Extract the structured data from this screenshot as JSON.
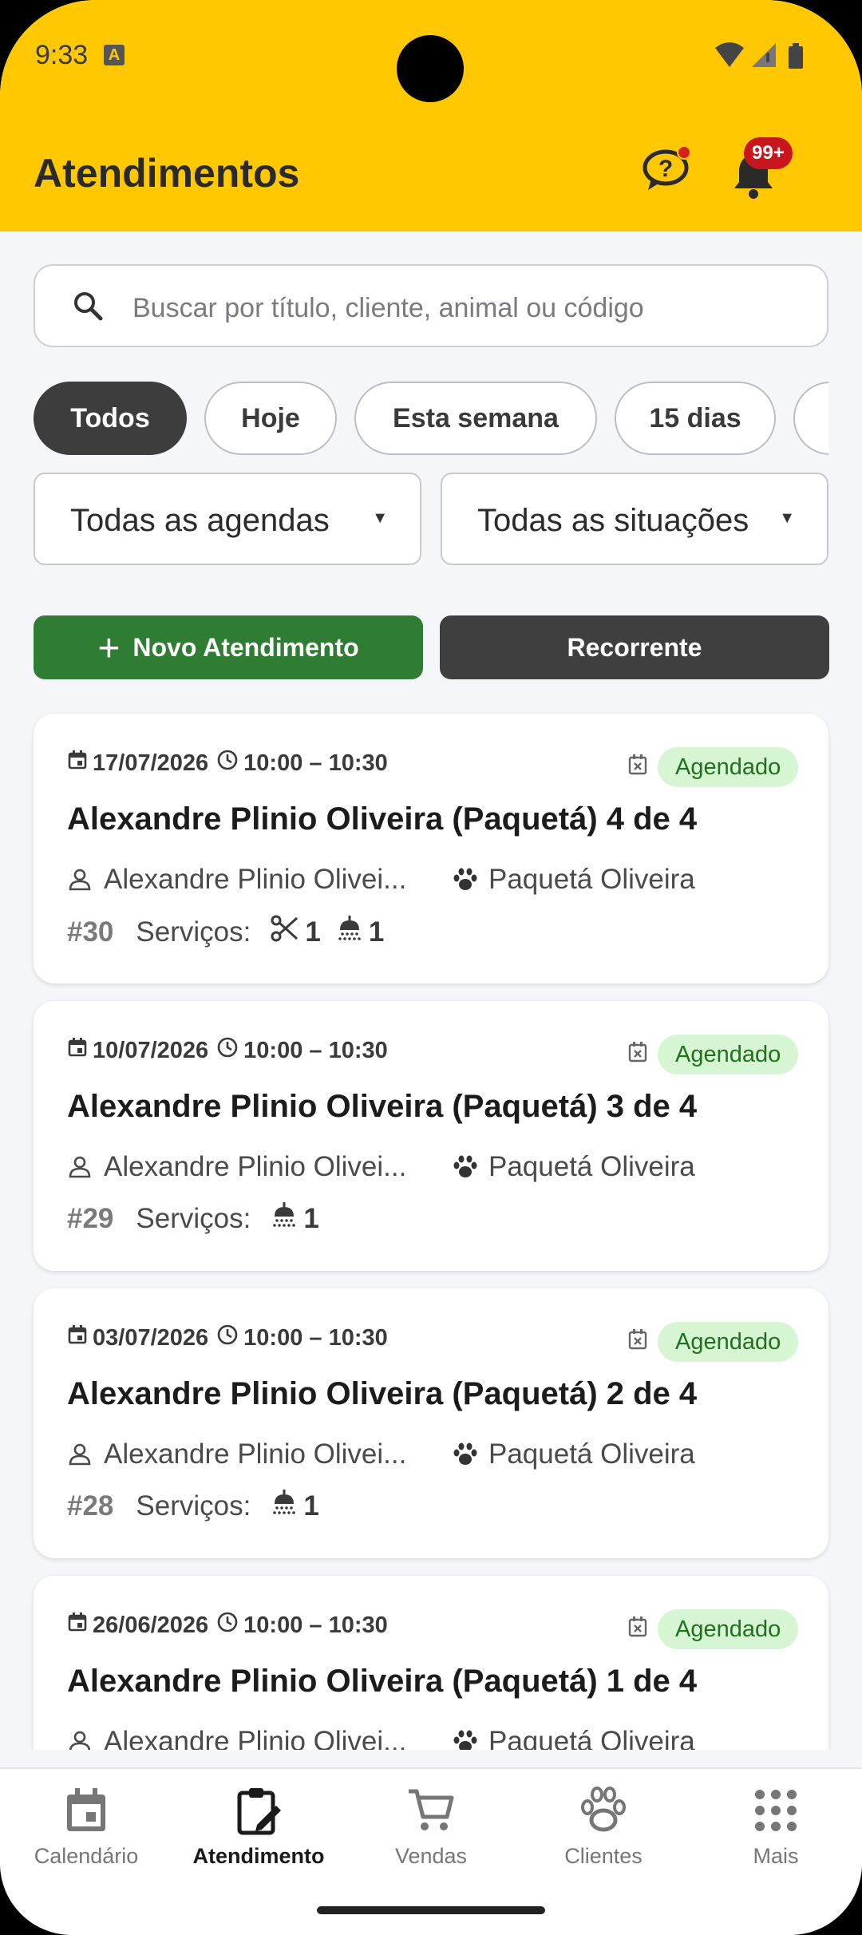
{
  "status_bar": {
    "time": "9:33",
    "notification_icon": "A"
  },
  "header": {
    "title": "Atendimentos",
    "notifications_badge": "99+",
    "help_icon": "help-chat-icon",
    "bell_icon": "bell-icon"
  },
  "search": {
    "placeholder": "Buscar por título, cliente, animal ou código"
  },
  "filters": {
    "chips": [
      "Todos",
      "Hoje",
      "Esta semana",
      "15 dias"
    ],
    "active_chip": "Todos",
    "agenda_select": "Todas as agendas",
    "situacao_select": "Todas as situações",
    "dropdown_arrow": "▼"
  },
  "actions": {
    "new_label": "Novo Atendimento",
    "plus": "+",
    "recurring_label": "Recorrente"
  },
  "appointments": [
    {
      "date": "17/07/2026",
      "time": "10:00 – 10:30",
      "status": "Agendado",
      "title": "Alexandre Plinio Oliveira (Paquetá) 4 de 4",
      "client": "Alexandre Plinio Olivei...",
      "pet": "Paquetá Oliveira",
      "code": "#30",
      "services_label": "Serviços:",
      "services": [
        {
          "icon": "scissors-icon",
          "count": "1"
        },
        {
          "icon": "shower-icon",
          "count": "1"
        }
      ]
    },
    {
      "date": "10/07/2026",
      "time": "10:00 – 10:30",
      "status": "Agendado",
      "title": "Alexandre Plinio Oliveira (Paquetá) 3 de 4",
      "client": "Alexandre Plinio Olivei...",
      "pet": "Paquetá Oliveira",
      "code": "#29",
      "services_label": "Serviços:",
      "services": [
        {
          "icon": "shower-icon",
          "count": "1"
        }
      ]
    },
    {
      "date": "03/07/2026",
      "time": "10:00 – 10:30",
      "status": "Agendado",
      "title": "Alexandre Plinio Oliveira (Paquetá) 2 de 4",
      "client": "Alexandre Plinio Olivei...",
      "pet": "Paquetá Oliveira",
      "code": "#28",
      "services_label": "Serviços:",
      "services": [
        {
          "icon": "shower-icon",
          "count": "1"
        }
      ]
    },
    {
      "date": "26/06/2026",
      "time": "10:00 – 10:30",
      "status": "Agendado",
      "title": "Alexandre Plinio Oliveira (Paquetá) 1 de 4",
      "client": "Alexandre Plinio Olivei...",
      "pet": "Paquetá Oliveira",
      "code": "",
      "services_label": "",
      "services": []
    }
  ],
  "bottom_nav": [
    {
      "label": "Calendário",
      "icon": "calendar-icon",
      "active": false
    },
    {
      "label": "Atendimento",
      "icon": "clipboard-edit-icon",
      "active": true
    },
    {
      "label": "Vendas",
      "icon": "cart-icon",
      "active": false
    },
    {
      "label": "Clientes",
      "icon": "paw-icon",
      "active": false
    },
    {
      "label": "Mais",
      "icon": "grid-dots-icon",
      "active": false
    }
  ],
  "colors": {
    "header": "#ffc800",
    "primary_green": "#2e7d32",
    "dark": "#3d3d3d",
    "badge_bg": "#d6f5d2",
    "badge_text": "#21701f",
    "notification_red": "#c8161c"
  }
}
